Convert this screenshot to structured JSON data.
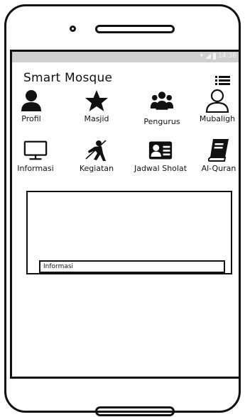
{
  "status_bar": {
    "time": "14:36"
  },
  "app": {
    "title": "Smart Mosque"
  },
  "menu_row1": [
    {
      "label": "Profil",
      "icon": "user-icon"
    },
    {
      "label": "Masjid",
      "icon": "star-icon"
    },
    {
      "label": "Pengurus",
      "icon": "users-icon"
    },
    {
      "label": "Mubaligh",
      "icon": "user-outline-icon"
    }
  ],
  "menu_row2": [
    {
      "label": "Informasi",
      "icon": "monitor-icon"
    },
    {
      "label": "Kegiatan",
      "icon": "fencing-icon"
    },
    {
      "label": "Jadwal Sholat",
      "icon": "id-card-icon"
    },
    {
      "label": "Al-Quran",
      "icon": "book-icon"
    }
  ],
  "info_panel": {
    "caption": "Informasi"
  }
}
